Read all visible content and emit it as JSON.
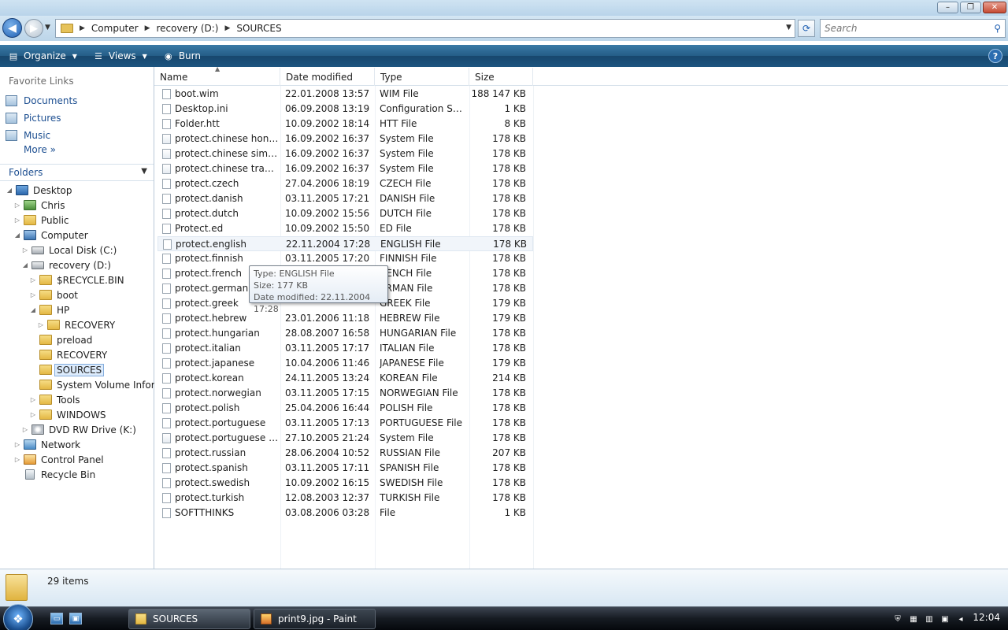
{
  "window": {
    "minimize": "–",
    "maximize": "❐",
    "close": "✕"
  },
  "address": {
    "crumbs": [
      "Computer",
      "recovery (D:)",
      "SOURCES"
    ],
    "search_placeholder": "Search"
  },
  "toolbar": {
    "organize": "Organize",
    "views": "Views",
    "burn": "Burn"
  },
  "nav": {
    "favorite_links_title": "Favorite Links",
    "favorites": [
      "Documents",
      "Pictures",
      "Music"
    ],
    "more": "More",
    "folders_title": "Folders",
    "tree": [
      {
        "label": "Desktop",
        "icon": "desktop-icon"
      },
      {
        "label": "Chris",
        "icon": "user-folder-icon"
      },
      {
        "label": "Public",
        "icon": "folder-icon"
      },
      {
        "label": "Computer",
        "icon": "computer-icon"
      },
      {
        "label": "Local Disk (C:)",
        "icon": "drive-icon"
      },
      {
        "label": "recovery (D:)",
        "icon": "drive-icon"
      },
      {
        "label": "$RECYCLE.BIN",
        "icon": "folder-icon"
      },
      {
        "label": "boot",
        "icon": "folder-icon"
      },
      {
        "label": "HP",
        "icon": "folder-icon"
      },
      {
        "label": "RECOVERY",
        "icon": "folder-icon"
      },
      {
        "label": "preload",
        "icon": "folder-icon"
      },
      {
        "label": "RECOVERY",
        "icon": "folder-icon"
      },
      {
        "label": "SOURCES",
        "icon": "folder-icon"
      },
      {
        "label": "System Volume Inform",
        "icon": "folder-icon"
      },
      {
        "label": "Tools",
        "icon": "folder-icon"
      },
      {
        "label": "WINDOWS",
        "icon": "folder-icon"
      },
      {
        "label": "DVD RW Drive (K:)",
        "icon": "dvd-icon"
      },
      {
        "label": "Network",
        "icon": "network-icon"
      },
      {
        "label": "Control Panel",
        "icon": "control-panel-icon"
      },
      {
        "label": "Recycle Bin",
        "icon": "recycle-bin-icon"
      }
    ]
  },
  "columns": {
    "name": "Name",
    "date": "Date modified",
    "type": "Type",
    "size": "Size"
  },
  "files": [
    {
      "name": "boot.wim",
      "date": "22.01.2008 13:57",
      "type": "WIM File",
      "size": "188 147 KB"
    },
    {
      "name": "Desktop.ini",
      "date": "06.09.2008 13:19",
      "type": "Configuration Sett...",
      "size": "1 KB"
    },
    {
      "name": "Folder.htt",
      "date": "10.09.2002 18:14",
      "type": "HTT File",
      "size": "8 KB"
    },
    {
      "name": "protect.chinese hong k...",
      "date": "16.09.2002 16:37",
      "type": "System File",
      "size": "178 KB"
    },
    {
      "name": "protect.chinese simplif...",
      "date": "16.09.2002 16:37",
      "type": "System File",
      "size": "178 KB"
    },
    {
      "name": "protect.chinese traditi...",
      "date": "16.09.2002 16:37",
      "type": "System File",
      "size": "178 KB"
    },
    {
      "name": "protect.czech",
      "date": "27.04.2006 18:19",
      "type": "CZECH File",
      "size": "178 KB"
    },
    {
      "name": "protect.danish",
      "date": "03.11.2005 17:21",
      "type": "DANISH File",
      "size": "178 KB"
    },
    {
      "name": "protect.dutch",
      "date": "10.09.2002 15:56",
      "type": "DUTCH File",
      "size": "178 KB"
    },
    {
      "name": "Protect.ed",
      "date": "10.09.2002 15:50",
      "type": "ED File",
      "size": "178 KB"
    },
    {
      "name": "protect.english",
      "date": "22.11.2004 17:28",
      "type": "ENGLISH File",
      "size": "178 KB"
    },
    {
      "name": "protect.finnish",
      "date": "03.11.2005 17:20",
      "type": "FINNISH File",
      "size": "178 KB"
    },
    {
      "name": "protect.french",
      "date": "",
      "type": "RENCH File",
      "size": "178 KB"
    },
    {
      "name": "protect.german",
      "date": "",
      "type": "ERMAN File",
      "size": "178 KB"
    },
    {
      "name": "protect.greek",
      "date": "",
      "type": "GREEK File",
      "size": "179 KB"
    },
    {
      "name": "protect.hebrew",
      "date": "23.01.2006 11:18",
      "type": "HEBREW File",
      "size": "179 KB"
    },
    {
      "name": "protect.hungarian",
      "date": "28.08.2007 16:58",
      "type": "HUNGARIAN File",
      "size": "178 KB"
    },
    {
      "name": "protect.italian",
      "date": "03.11.2005 17:17",
      "type": "ITALIAN File",
      "size": "178 KB"
    },
    {
      "name": "protect.japanese",
      "date": "10.04.2006 11:46",
      "type": "JAPANESE File",
      "size": "179 KB"
    },
    {
      "name": "protect.korean",
      "date": "24.11.2005 13:24",
      "type": "KOREAN File",
      "size": "214 KB"
    },
    {
      "name": "protect.norwegian",
      "date": "03.11.2005 17:15",
      "type": "NORWEGIAN File",
      "size": "178 KB"
    },
    {
      "name": "protect.polish",
      "date": "25.04.2006 16:44",
      "type": "POLISH File",
      "size": "178 KB"
    },
    {
      "name": "protect.portuguese",
      "date": "03.11.2005 17:13",
      "type": "PORTUGUESE File",
      "size": "178 KB"
    },
    {
      "name": "protect.portuguese bra...",
      "date": "27.10.2005 21:24",
      "type": "System File",
      "size": "178 KB"
    },
    {
      "name": "protect.russian",
      "date": "28.06.2004 10:52",
      "type": "RUSSIAN File",
      "size": "207 KB"
    },
    {
      "name": "protect.spanish",
      "date": "03.11.2005 17:11",
      "type": "SPANISH File",
      "size": "178 KB"
    },
    {
      "name": "protect.swedish",
      "date": "10.09.2002 16:15",
      "type": "SWEDISH File",
      "size": "178 KB"
    },
    {
      "name": "protect.turkish",
      "date": "12.08.2003 12:37",
      "type": "TURKISH File",
      "size": "178 KB"
    },
    {
      "name": "SOFTTHINKS",
      "date": "03.08.2006 03:28",
      "type": "File",
      "size": "1 KB"
    }
  ],
  "tooltip": {
    "type": "Type: ENGLISH File",
    "size": "Size: 177 KB",
    "date": "Date modified: 22.11.2004 17:28"
  },
  "details": {
    "count": "29 items"
  },
  "taskbar": {
    "tasks": [
      "SOURCES",
      "print9.jpg - Paint"
    ],
    "clock": "12:04"
  }
}
